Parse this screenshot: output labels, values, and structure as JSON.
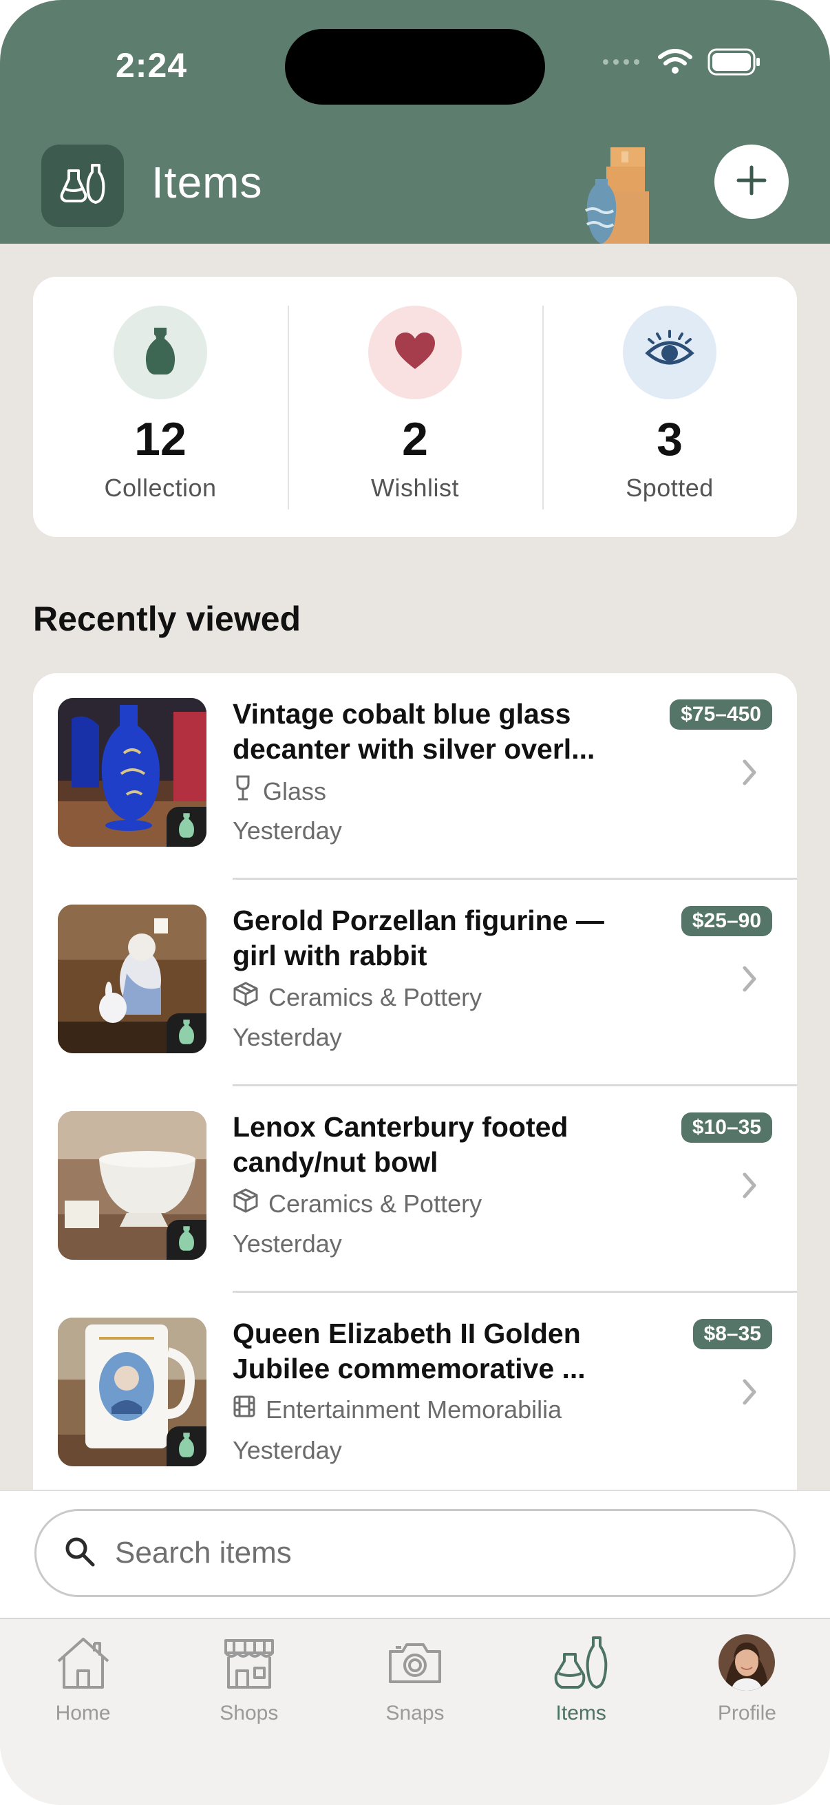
{
  "status": {
    "time": "2:24"
  },
  "header": {
    "title": "Items",
    "logo_icon": "vases-icon",
    "add_icon": "plus-icon",
    "color": "#5d7e6f"
  },
  "stats": [
    {
      "count": "12",
      "label": "Collection",
      "icon": "vase-icon",
      "bg": "#e3ece6",
      "fg": "#3d6653"
    },
    {
      "count": "2",
      "label": "Wishlist",
      "icon": "heart-icon",
      "bg": "#f9e1e1",
      "fg": "#a63d4c"
    },
    {
      "count": "3",
      "label": "Spotted",
      "icon": "eye-icon",
      "bg": "#e1ebf6",
      "fg": "#2c4f78"
    }
  ],
  "recent": {
    "title": "Recently viewed",
    "items": [
      {
        "title": "Vintage cobalt blue glass decanter with silver overl...",
        "category": "Glass",
        "category_icon": "wine-glass-icon",
        "date": "Yesterday",
        "price": "$75–450"
      },
      {
        "title": "Gerold Porzellan figurine — girl with rabbit",
        "category": "Ceramics & Pottery",
        "category_icon": "box-icon",
        "date": "Yesterday",
        "price": "$25–90"
      },
      {
        "title": "Lenox Canterbury footed candy/nut bowl",
        "category": "Ceramics & Pottery",
        "category_icon": "box-icon",
        "date": "Yesterday",
        "price": "$10–35"
      },
      {
        "title": "Queen Elizabeth II Golden Jubilee commemorative ...",
        "category": "Entertainment Memorabilia",
        "category_icon": "film-icon",
        "date": "Yesterday",
        "price": "$8–35"
      }
    ]
  },
  "search": {
    "placeholder": "Search items"
  },
  "tabs": [
    {
      "label": "Home",
      "icon": "house-icon"
    },
    {
      "label": "Shops",
      "icon": "storefront-icon"
    },
    {
      "label": "Snaps",
      "icon": "camera-icon"
    },
    {
      "label": "Items",
      "icon": "vases-icon",
      "active": true
    },
    {
      "label": "Profile",
      "icon": "avatar"
    }
  ]
}
